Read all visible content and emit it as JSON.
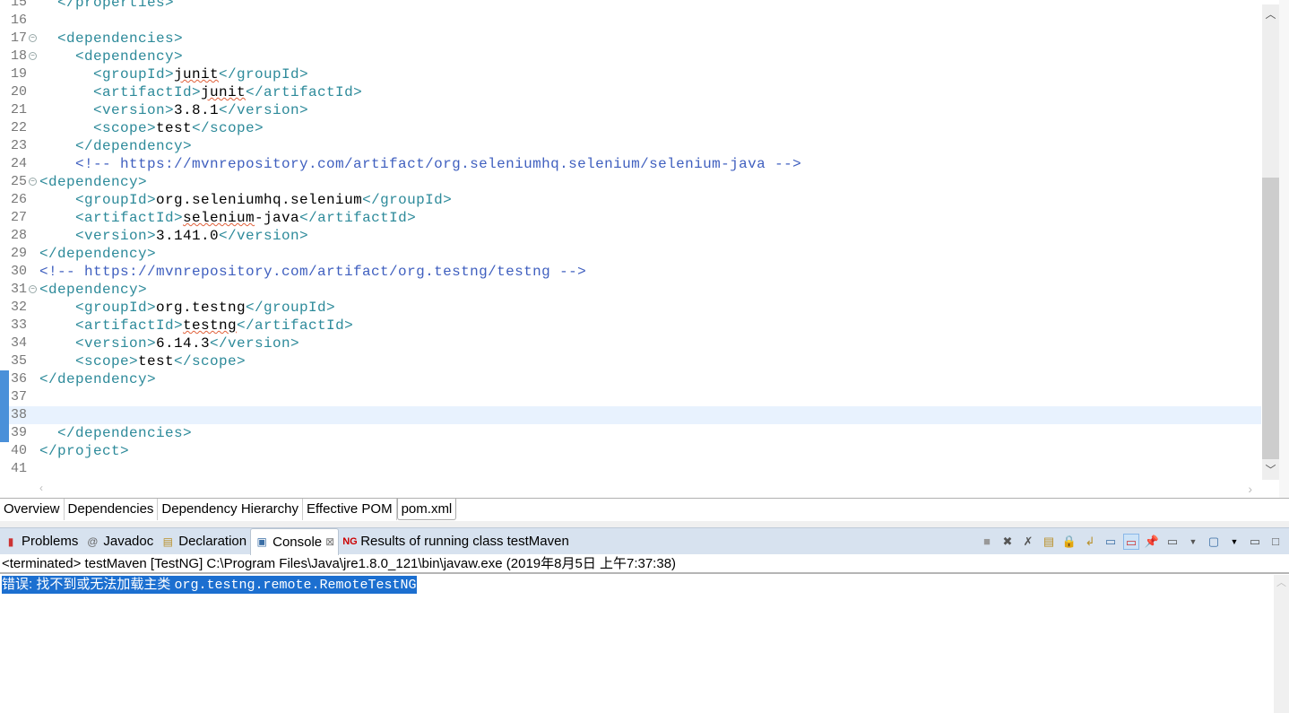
{
  "editor": {
    "current_line": 38,
    "lines": [
      {
        "n": "15",
        "segs": [
          {
            "c": "tag",
            "v": "  </properties>"
          }
        ]
      },
      {
        "n": "16",
        "segs": []
      },
      {
        "n": "17",
        "fold": true,
        "segs": [
          {
            "c": "tag",
            "v": "  <dependencies>"
          }
        ]
      },
      {
        "n": "18",
        "fold": true,
        "segs": [
          {
            "c": "tag",
            "v": "    <dependency>"
          }
        ]
      },
      {
        "n": "19",
        "segs": [
          {
            "c": "tag",
            "v": "      <groupId>"
          },
          {
            "c": "text squig",
            "v": "junit"
          },
          {
            "c": "tag",
            "v": "</groupId>"
          }
        ]
      },
      {
        "n": "20",
        "segs": [
          {
            "c": "tag",
            "v": "      <artifactId>"
          },
          {
            "c": "text squig",
            "v": "junit"
          },
          {
            "c": "tag",
            "v": "</artifactId>"
          }
        ]
      },
      {
        "n": "21",
        "segs": [
          {
            "c": "tag",
            "v": "      <version>"
          },
          {
            "c": "text",
            "v": "3.8.1"
          },
          {
            "c": "tag",
            "v": "</version>"
          }
        ]
      },
      {
        "n": "22",
        "segs": [
          {
            "c": "tag",
            "v": "      <scope>"
          },
          {
            "c": "text",
            "v": "test"
          },
          {
            "c": "tag",
            "v": "</scope>"
          }
        ]
      },
      {
        "n": "23",
        "segs": [
          {
            "c": "tag",
            "v": "    </dependency>"
          }
        ]
      },
      {
        "n": "24",
        "segs": [
          {
            "c": "comment",
            "v": "    <!-- https://mvnrepository.com/artifact/org.seleniumhq.selenium/selenium-java -->"
          }
        ]
      },
      {
        "n": "25",
        "fold": true,
        "segs": [
          {
            "c": "tag",
            "v": "<dependency>"
          }
        ]
      },
      {
        "n": "26",
        "segs": [
          {
            "c": "tag",
            "v": "    <groupId>"
          },
          {
            "c": "text",
            "v": "org.seleniumhq.selenium"
          },
          {
            "c": "tag",
            "v": "</groupId>"
          }
        ]
      },
      {
        "n": "27",
        "segs": [
          {
            "c": "tag",
            "v": "    <artifactId>"
          },
          {
            "c": "text squig",
            "v": "selenium"
          },
          {
            "c": "text",
            "v": "-java"
          },
          {
            "c": "tag",
            "v": "</artifactId>"
          }
        ]
      },
      {
        "n": "28",
        "segs": [
          {
            "c": "tag",
            "v": "    <version>"
          },
          {
            "c": "text",
            "v": "3.141.0"
          },
          {
            "c": "tag",
            "v": "</version>"
          }
        ]
      },
      {
        "n": "29",
        "segs": [
          {
            "c": "tag",
            "v": "</dependency>"
          }
        ]
      },
      {
        "n": "30",
        "segs": [
          {
            "c": "comment",
            "v": "<!-- https://mvnrepository.com/artifact/org.testng/testng -->"
          }
        ]
      },
      {
        "n": "31",
        "fold": true,
        "segs": [
          {
            "c": "tag",
            "v": "<dependency>"
          }
        ]
      },
      {
        "n": "32",
        "segs": [
          {
            "c": "tag",
            "v": "    <groupId>"
          },
          {
            "c": "text",
            "v": "org.testng"
          },
          {
            "c": "tag",
            "v": "</groupId>"
          }
        ]
      },
      {
        "n": "33",
        "segs": [
          {
            "c": "tag",
            "v": "    <artifactId>"
          },
          {
            "c": "text squig",
            "v": "testng"
          },
          {
            "c": "tag",
            "v": "</artifactId>"
          }
        ]
      },
      {
        "n": "34",
        "segs": [
          {
            "c": "tag",
            "v": "    <version>"
          },
          {
            "c": "text",
            "v": "6.14.3"
          },
          {
            "c": "tag",
            "v": "</version>"
          }
        ]
      },
      {
        "n": "35",
        "segs": [
          {
            "c": "tag",
            "v": "    <scope>"
          },
          {
            "c": "text",
            "v": "test"
          },
          {
            "c": "tag",
            "v": "</scope>"
          }
        ]
      },
      {
        "n": "36",
        "segs": [
          {
            "c": "tag",
            "v": "</dependency>"
          }
        ]
      },
      {
        "n": "37",
        "segs": []
      },
      {
        "n": "38",
        "segs": []
      },
      {
        "n": "39",
        "segs": [
          {
            "c": "tag",
            "v": "  </dependencies>"
          }
        ]
      },
      {
        "n": "40",
        "segs": [
          {
            "c": "tag",
            "v": "</project>"
          }
        ]
      },
      {
        "n": "41",
        "segs": []
      }
    ]
  },
  "editor_tabs": [
    "Overview",
    "Dependencies",
    "Dependency Hierarchy",
    "Effective POM",
    "pom.xml"
  ],
  "active_editor_tab": "pom.xml",
  "panel": {
    "tabs": [
      {
        "label": "Problems",
        "icon": "problems-icon"
      },
      {
        "label": "Javadoc",
        "icon": "javadoc-at-icon"
      },
      {
        "label": "Declaration",
        "icon": "declaration-icon"
      },
      {
        "label": "Console",
        "icon": "console-icon",
        "active": true,
        "close": "⊠"
      },
      {
        "label": "Results of running class testMaven",
        "icon": "testng-icon"
      }
    ],
    "status": "<terminated> testMaven [TestNG] C:\\Program Files\\Java\\jre1.8.0_121\\bin\\javaw.exe (2019年8月5日 上午7:37:38)",
    "console_error_prefix": "错误: 找不到或无法加载主类 ",
    "console_error_class": "org.testng.remote.RemoteTestNG"
  },
  "colors": {
    "tag": "#2d8a9a",
    "comment": "#3f5fbf",
    "selection": "#1c6fd0"
  }
}
